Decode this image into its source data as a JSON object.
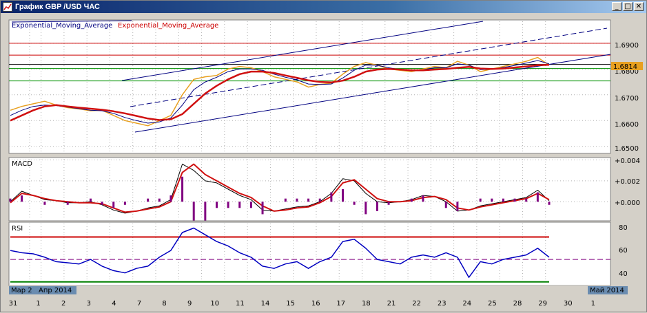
{
  "window": {
    "title": "График GBP /USD ЧАС",
    "buttons": {
      "minimize": "_",
      "maximize": "□",
      "close": "✕"
    }
  },
  "colors": {
    "price": "#e8a020",
    "ema_fast": "#000080",
    "ema_slow": "#d01010",
    "channel": "#000080",
    "macd_line": "#000000",
    "signal_line": "#d01010",
    "histogram": "#800080",
    "rsi_line": "#0000c0",
    "rsi_overbought": "#ff20ff",
    "level_red": "#cc0000",
    "level_green": "#009000",
    "price_badge": "#e8a020"
  },
  "chart_data": [
    {
      "type": "line",
      "panel": "price",
      "legend": [
        "Exponential_Moving_Average",
        "Exponential_Moving_Average"
      ],
      "y_ticks": [
        "1.6900",
        "1.6800",
        "1.6700",
        "1.6600",
        "1.6500"
      ],
      "ylim": [
        1.6478,
        1.6985
      ],
      "current_price": "1.6814",
      "horizontal_levels": [
        {
          "value": 1.69,
          "color": "red"
        },
        {
          "value": 1.6854,
          "color": "red"
        },
        {
          "value": 1.6818,
          "color": "black"
        },
        {
          "value": 1.6802,
          "color": "green"
        },
        {
          "value": 1.6754,
          "color": "green"
        }
      ],
      "series": [
        {
          "key": "price",
          "values": [
            1.664,
            1.6655,
            1.6665,
            1.6675,
            1.666,
            1.665,
            1.6645,
            1.6638,
            1.664,
            1.662,
            1.66,
            1.659,
            1.658,
            1.66,
            1.662,
            1.67,
            1.676,
            1.677,
            1.6775,
            1.68,
            1.681,
            1.6805,
            1.679,
            1.677,
            1.676,
            1.675,
            1.673,
            1.674,
            1.6745,
            1.678,
            1.681,
            1.6825,
            1.6815,
            1.68,
            1.6795,
            1.679,
            1.68,
            1.681,
            1.6805,
            1.683,
            1.6815,
            1.679,
            1.68,
            1.681,
            1.682,
            1.683,
            1.6845,
            1.6815
          ]
        },
        {
          "key": "ema_fast",
          "values": [
            1.662,
            1.664,
            1.6655,
            1.666,
            1.6658,
            1.6652,
            1.6646,
            1.664,
            1.6638,
            1.6628,
            1.6612,
            1.66,
            1.659,
            1.6595,
            1.661,
            1.666,
            1.672,
            1.675,
            1.6768,
            1.679,
            1.68,
            1.68,
            1.6795,
            1.678,
            1.6768,
            1.6758,
            1.6742,
            1.674,
            1.6742,
            1.6765,
            1.6795,
            1.6815,
            1.6815,
            1.6805,
            1.6798,
            1.6793,
            1.6797,
            1.6805,
            1.6805,
            1.682,
            1.6815,
            1.6798,
            1.6799,
            1.6806,
            1.6814,
            1.6823,
            1.6833,
            1.682
          ]
        },
        {
          "key": "ema_slow",
          "values": [
            1.66,
            1.662,
            1.664,
            1.6655,
            1.666,
            1.6655,
            1.665,
            1.6646,
            1.6642,
            1.6636,
            1.6628,
            1.6618,
            1.6608,
            1.6602,
            1.6605,
            1.6625,
            1.6665,
            1.6705,
            1.6735,
            1.676,
            1.678,
            1.679,
            1.679,
            1.6785,
            1.6775,
            1.6766,
            1.6756,
            1.675,
            1.6748,
            1.6755,
            1.677,
            1.679,
            1.6798,
            1.68,
            1.6798,
            1.6795,
            1.6795,
            1.6798,
            1.68,
            1.6805,
            1.6808,
            1.6802,
            1.68,
            1.6802,
            1.6806,
            1.681,
            1.6815,
            1.6816
          ]
        }
      ]
    },
    {
      "type": "line",
      "panel": "macd",
      "legend": [
        "MACD"
      ],
      "y_ticks": [
        "+0.004",
        "+0.002",
        "+0.000"
      ],
      "ylim": [
        -0.0017,
        0.0041
      ],
      "series": [
        {
          "key": "macd",
          "values": [
            0.0,
            0.001,
            0.0006,
            0.0002,
            0.0001,
            -0.0001,
            -0.0001,
            0.0,
            -0.0003,
            -0.0008,
            -0.0011,
            -0.0009,
            -0.0006,
            -0.0004,
            0.0002,
            0.0036,
            0.003,
            0.002,
            0.0018,
            0.0012,
            0.0006,
            0.0002,
            -0.0008,
            -0.0009,
            -0.0007,
            -0.0005,
            -0.0004,
            0.0,
            0.0008,
            0.0022,
            0.002,
            0.0008,
            0.0,
            -0.0001,
            0.0,
            0.0002,
            0.0006,
            0.0005,
            0.0,
            -0.0009,
            -0.0008,
            -0.0004,
            -0.0002,
            0.0,
            0.0002,
            0.0004,
            0.0011,
            0.0001
          ]
        },
        {
          "key": "signal",
          "values": [
            -0.0001,
            0.0008,
            0.0006,
            0.0003,
            0.0001,
            0.0,
            -0.0001,
            -0.0001,
            -0.0002,
            -0.0006,
            -0.001,
            -0.0009,
            -0.0007,
            -0.0005,
            0.0,
            0.0028,
            0.0036,
            0.0026,
            0.002,
            0.0014,
            0.0008,
            0.0004,
            -0.0004,
            -0.0009,
            -0.0008,
            -0.0006,
            -0.0005,
            -0.0001,
            0.0005,
            0.0018,
            0.0021,
            0.0012,
            0.0003,
            0.0,
            0.0,
            0.0001,
            0.0004,
            0.0005,
            0.0002,
            -0.0006,
            -0.0008,
            -0.0005,
            -0.0003,
            -0.0001,
            0.0001,
            0.0003,
            0.0008,
            0.0002
          ]
        }
      ]
    },
    {
      "type": "line",
      "panel": "rsi",
      "legend": [
        "RSI"
      ],
      "y_ticks": [
        "80",
        "60",
        "40"
      ],
      "ylim": [
        28,
        82
      ],
      "levels": [
        70,
        50,
        30
      ],
      "series": [
        {
          "key": "rsi",
          "values": [
            58,
            56,
            55,
            52,
            48,
            47,
            46,
            50,
            44,
            40,
            38,
            42,
            44,
            52,
            58,
            74,
            78,
            72,
            66,
            62,
            56,
            52,
            44,
            42,
            46,
            48,
            42,
            48,
            52,
            66,
            68,
            60,
            50,
            48,
            46,
            52,
            54,
            52,
            56,
            52,
            34,
            48,
            46,
            50,
            52,
            54,
            60,
            52
          ]
        }
      ]
    }
  ],
  "x_axis": {
    "labels": [
      {
        "label": "31",
        "x": 0.5
      },
      {
        "label": "1",
        "x": 1.5
      },
      {
        "label": "2",
        "x": 3.5
      },
      {
        "label": "3",
        "x": 5.5
      },
      {
        "label": "4",
        "x": 7.5
      },
      {
        "label": "7",
        "x": 9.5
      },
      {
        "label": "8",
        "x": 11.5
      },
      {
        "label": "9",
        "x": 13.5
      },
      {
        "label": "10",
        "x": 15.5
      },
      {
        "label": "11",
        "x": 17.5
      },
      {
        "label": "14",
        "x": 19.5
      },
      {
        "label": "15",
        "x": 21.5
      },
      {
        "label": "16",
        "x": 23.5
      },
      {
        "label": "17",
        "x": 25.5
      },
      {
        "label": "18",
        "x": 27.5
      },
      {
        "label": "21",
        "x": 29.5
      },
      {
        "label": "22",
        "x": 31.5
      },
      {
        "label": "23",
        "x": 33.5
      },
      {
        "label": "24",
        "x": 35.5
      },
      {
        "label": "25",
        "x": 37.5
      },
      {
        "label": "28",
        "x": 39.5
      },
      {
        "label": "29",
        "x": 41.5
      },
      {
        "label": "30",
        "x": 43.5
      },
      {
        "label": "1",
        "x": 45.5
      }
    ],
    "months": [
      {
        "label": "Мар 2",
        "x": 0
      },
      {
        "label": "Апр 2014",
        "x": 1.5
      },
      {
        "label": "Май 2014",
        "x": 45
      }
    ]
  }
}
